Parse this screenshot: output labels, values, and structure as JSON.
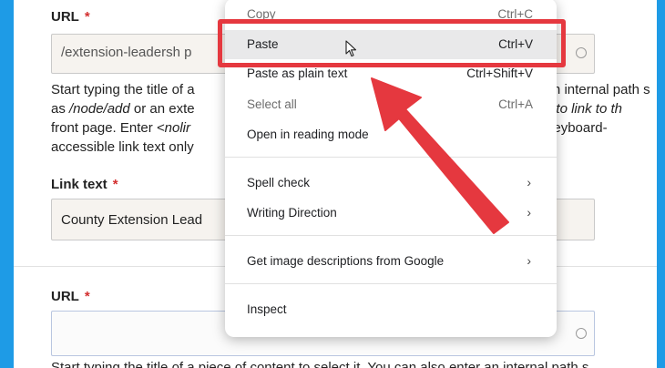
{
  "form": {
    "url_label": "URL",
    "required_mark": "*",
    "url_value": "/extension-leadersh p",
    "desc_line1_start": "Start typing the title of a",
    "desc_line1_end": "an internal path s",
    "desc_line2_a": "as ",
    "desc_line2_node": "/node/add",
    "desc_line2_b": " or an exte",
    "desc_line2_c": "ont> to link to th",
    "desc_line3_a": "front page. Enter ",
    "desc_line3_b": "<nolir",
    "desc_line3_c": "lisplay keyboard-",
    "desc_line4": "accessible link text only",
    "link_text_label": "Link text",
    "link_text_value": "County Extension Lead",
    "url2_label": "URL",
    "url2_value": "",
    "desc2_partial": "Start typing the title of a piece of content to select it. You can also enter an internal path s"
  },
  "context_menu": {
    "copy": {
      "label": "Copy",
      "shortcut": "Ctrl+C"
    },
    "paste": {
      "label": "Paste",
      "shortcut": "Ctrl+V"
    },
    "paste_plain": {
      "label": "Paste as plain text",
      "shortcut": "Ctrl+Shift+V"
    },
    "select_all": {
      "label": "Select all",
      "shortcut": "Ctrl+A"
    },
    "reading_mode": {
      "label": "Open in reading mode"
    },
    "spell_check": {
      "label": "Spell check"
    },
    "writing_direction": {
      "label": "Writing Direction"
    },
    "image_descriptions": {
      "label": "Get image descriptions from Google"
    },
    "inspect": {
      "label": "Inspect"
    },
    "chevron": "›"
  },
  "colors": {
    "frame": "#1e9be6",
    "annotation_red": "#e5383f",
    "required_red": "#d32f2f"
  },
  "icons": {
    "cursor": "pointer-cursor-icon",
    "arrow": "annotation-arrow",
    "submenu": "chevron-right-icon"
  }
}
